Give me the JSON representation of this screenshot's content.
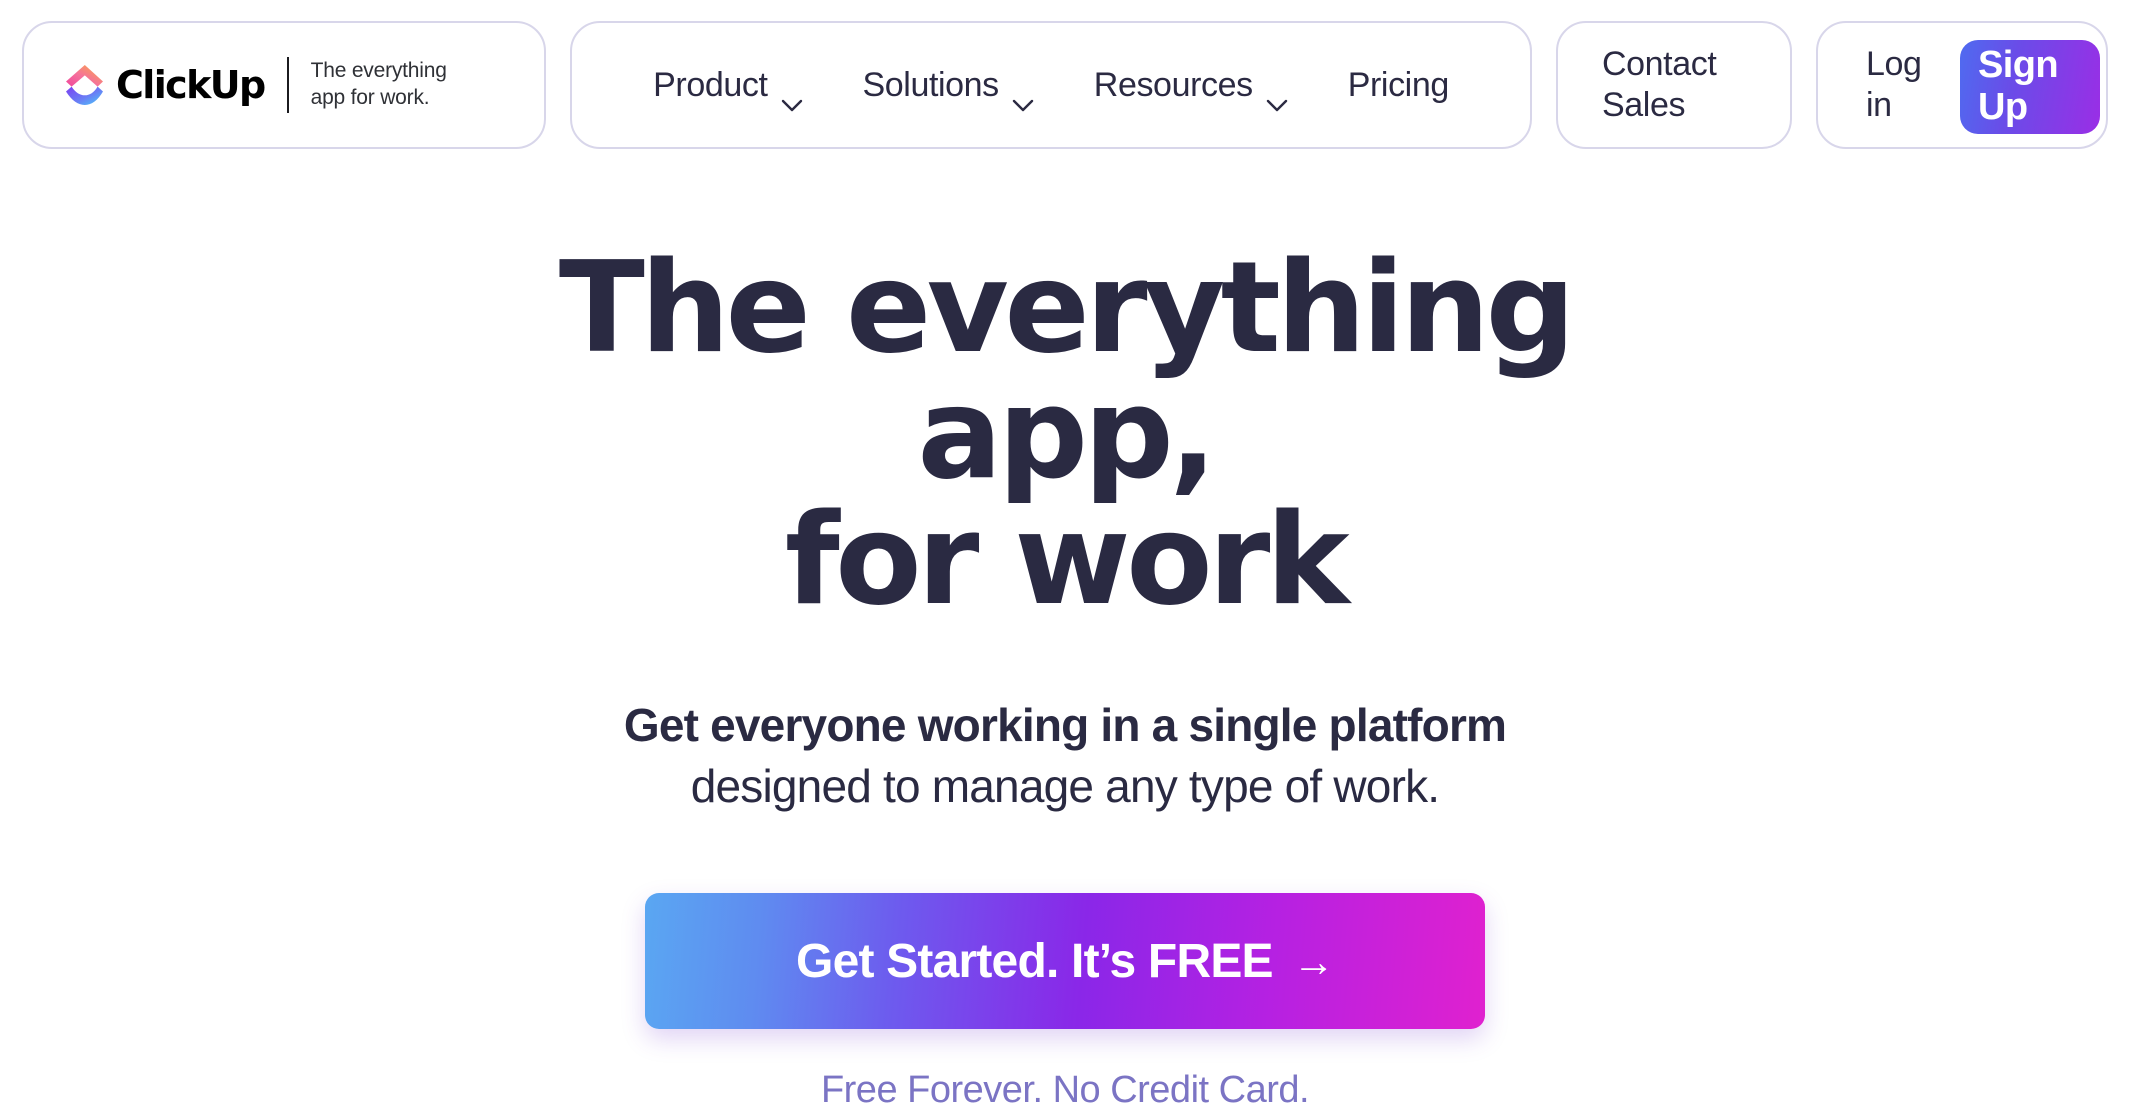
{
  "header": {
    "logo": {
      "wordmark": "ClickUp",
      "tagline_line1": "The everything",
      "tagline_line2": "app for work."
    },
    "nav_items": [
      {
        "label": "Product",
        "has_dropdown": true
      },
      {
        "label": "Solutions",
        "has_dropdown": true
      },
      {
        "label": "Resources",
        "has_dropdown": true
      },
      {
        "label": "Pricing",
        "has_dropdown": false
      }
    ],
    "contact_sales": {
      "line1": "Contact",
      "line2": "Sales"
    },
    "login": {
      "line1": "Log",
      "line2": "in"
    },
    "signup": {
      "line1": "Sign",
      "line2": "Up"
    }
  },
  "hero": {
    "title_line1": "The everything app,",
    "title_line2": "for work",
    "subtitle_bold": "Get everyone working in a single platform",
    "subtitle_rest": " designed to manage any type of work.",
    "cta_label": "Get Started. It’s FREE",
    "cta_arrow": "→",
    "cta_note": "Free Forever. No Credit Card."
  },
  "colors": {
    "background": "#ffffff",
    "text_dark": "#2a2a42",
    "pill_border": "#d8d6ea",
    "note_purple": "#7b74c4",
    "cta_gradient_start": "#5aa7f2",
    "cta_gradient_mid": "#8a27e8",
    "cta_gradient_end": "#e021cf",
    "signup_gradient_start": "#4f6bf0",
    "signup_gradient_end": "#9a2ee6",
    "logo_chevron_pink": "#f24f9e",
    "logo_chevron_orange": "#fba43c",
    "logo_arc_purple": "#7b3ff2",
    "logo_arc_blue": "#49ccf9"
  }
}
